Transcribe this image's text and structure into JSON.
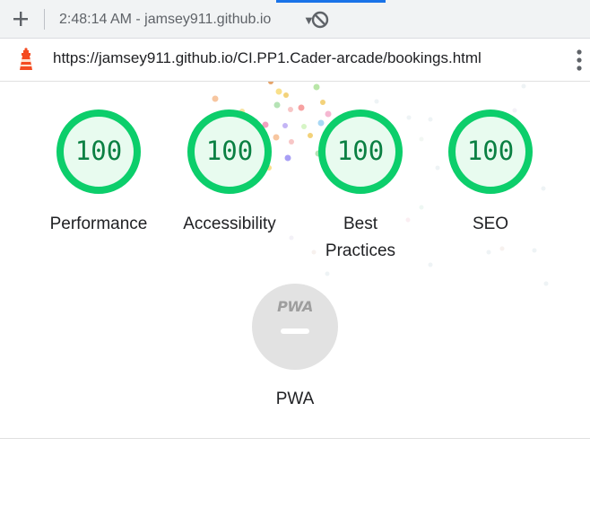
{
  "toolbar": {
    "add_icon": "plus-icon",
    "report_label": "2:48:14 AM - jamsey911.github.io",
    "dropdown_icon": "caret-down-icon",
    "clear_icon": "block-icon"
  },
  "urlbar": {
    "logo_icon": "lighthouse-icon",
    "url": "https://jamsey911.github.io/CI.PP1.Cader-arcade/bookings.html",
    "menu_icon": "more-vert-icon"
  },
  "scores": [
    {
      "score": "100",
      "label": "Performance"
    },
    {
      "score": "100",
      "label": "Accessibility"
    },
    {
      "score": "100",
      "label": "Best Practices"
    },
    {
      "score": "100",
      "label": "SEO"
    }
  ],
  "pwa": {
    "mark": "PWA",
    "label": "PWA"
  },
  "colors": {
    "pass_ring": "#0cce6b",
    "pass_fill": "#e8fbef",
    "pass_text": "#0b8043",
    "pwa_badge": "#e2e2e2",
    "accent_tab": "#1a73e8",
    "lighthouse_orange": "#f44b21"
  }
}
